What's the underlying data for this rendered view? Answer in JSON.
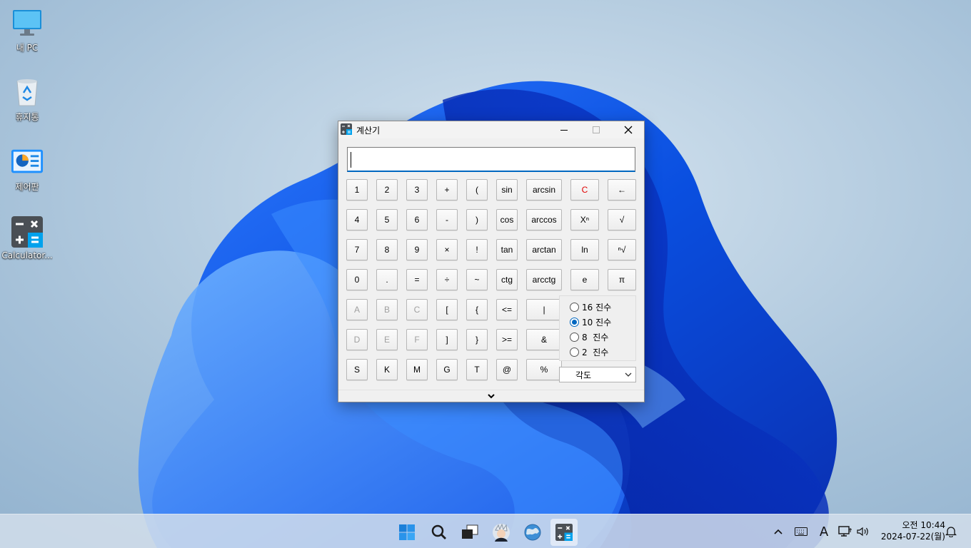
{
  "desktop": {
    "icons": [
      {
        "label": "내 PC",
        "icon": "monitor-icon"
      },
      {
        "label": "휴지통",
        "icon": "recycle-bin-icon"
      },
      {
        "label": "제어판",
        "icon": "control-panel-icon"
      },
      {
        "label": "Calculator...",
        "icon": "calculator-icon"
      }
    ]
  },
  "window": {
    "title": "계산기",
    "display_value": "",
    "keys": [
      [
        "1",
        "2",
        "3",
        "+",
        "(",
        "sin",
        "arcsin",
        "C",
        "←"
      ],
      [
        "4",
        "5",
        "6",
        "-",
        ")",
        "cos",
        "arccos",
        "Xⁿ",
        "√"
      ],
      [
        "7",
        "8",
        "9",
        "×",
        "!",
        "tan",
        "arctan",
        "ln",
        "ⁿ√"
      ],
      [
        "0",
        ".",
        "=",
        "÷",
        "~",
        "ctg",
        "arcctg",
        "e",
        "π"
      ],
      [
        "A",
        "B",
        "C",
        "[",
        "{",
        "<=",
        "|"
      ],
      [
        "D",
        "E",
        "F",
        "]",
        "}",
        ">=",
        "&"
      ],
      [
        "S",
        "K",
        "M",
        "G",
        "T",
        "@",
        "%"
      ]
    ],
    "base_options": [
      "16 진수",
      "10 진수",
      "8  진수",
      "2  진수"
    ],
    "selected_base": "10 진수",
    "angle_unit": "각도",
    "accent_color": "#0067c0",
    "clear_color": "#e00000"
  },
  "taskbar": {
    "apps": [
      "start-icon",
      "search-icon",
      "task-view-icon",
      "app-avatar-icon",
      "browser-globe-icon",
      "calculator-icon"
    ],
    "clock": {
      "time": "오전 10:44",
      "date": "2024-07-22(월)"
    },
    "tray": [
      "chevron-up-icon",
      "keyboard-icon",
      "ime-icon",
      "network-icon",
      "volume-icon",
      "bell-icon"
    ],
    "ime_label": "A"
  }
}
